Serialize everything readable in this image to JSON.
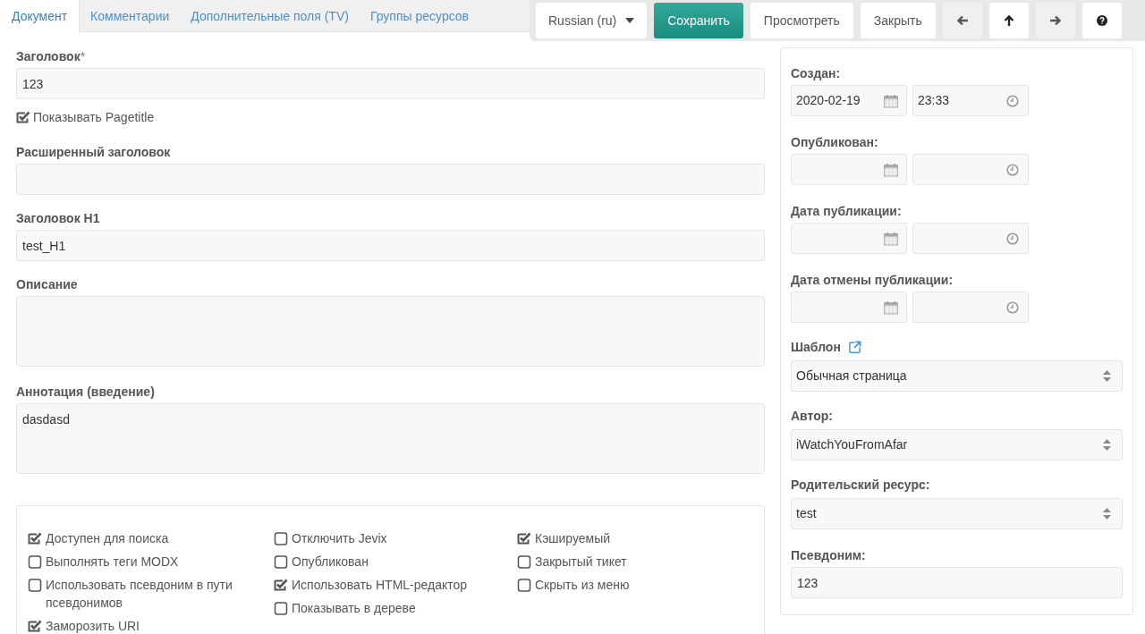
{
  "tabs": [
    {
      "label": "Документ",
      "selected": true
    },
    {
      "label": "Комментарии",
      "selected": false
    },
    {
      "label": "Дополнительные поля (TV)",
      "selected": false
    },
    {
      "label": "Группы ресурсов",
      "selected": false
    }
  ],
  "toolbar": {
    "language": "Russian (ru)",
    "buttons": [
      {
        "label": "Сохранить",
        "kind": "primary"
      },
      {
        "label": "Просмотреть",
        "kind": "default"
      },
      {
        "label": "Закрыть",
        "kind": "default"
      }
    ],
    "nav": [
      {
        "kind": "prev"
      },
      {
        "kind": "up"
      },
      {
        "kind": "next"
      },
      {
        "kind": "help"
      }
    ]
  },
  "main_fields": [
    {
      "kind": "input",
      "label": "Заголовок",
      "required_mark": "*",
      "value": "123"
    },
    {
      "kind": "checkbox",
      "label": "Показывать Pagetitle",
      "checked": true
    },
    {
      "kind": "input",
      "label": "Расширенный заголовок"
    },
    {
      "kind": "input",
      "label": "Заголовок H1",
      "value": "test_H1"
    },
    {
      "kind": "textarea",
      "label": "Описание"
    },
    {
      "kind": "textarea",
      "label": "Аннотация (введение)",
      "value": "dasdasd"
    }
  ],
  "options": [
    [
      {
        "label": "Доступен для поиска",
        "checked": true
      },
      {
        "label": "Выполнять теги MODX",
        "checked": false
      },
      {
        "label": "Использовать псевдоним в пути псевдонимов",
        "checked": false
      },
      {
        "label": "Заморозить URI",
        "checked": true
      }
    ],
    [
      {
        "label": "Отключить Jevix",
        "checked": false
      },
      {
        "label": "Опубликован",
        "checked": false
      },
      {
        "label": "Использовать HTML-редактор",
        "checked": true
      },
      {
        "label": "Показывать в дереве",
        "checked": false
      }
    ],
    [
      {
        "label": "Кэшируемый",
        "checked": true
      },
      {
        "label": "Закрытый тикет",
        "checked": false
      },
      {
        "label": "Скрыть из меню",
        "checked": false
      }
    ]
  ],
  "side_panel": {
    "dates": [
      {
        "label": "Создан:",
        "date": "2020-02-19",
        "time": "23:33"
      },
      {
        "label": "Опубликован:"
      },
      {
        "label": "Дата публикации:"
      },
      {
        "label": "Дата отмены публикации:"
      }
    ],
    "selects": [
      {
        "label": "Шаблон",
        "link": true,
        "value": "Обычная страница"
      },
      {
        "label": "Автор:",
        "link": false,
        "value": "iWatchYouFromAfar"
      },
      {
        "label": "Родительский ресурс:",
        "link": false,
        "value": "test"
      }
    ],
    "alias": {
      "label": "Псевдоним:",
      "value": "123"
    }
  }
}
